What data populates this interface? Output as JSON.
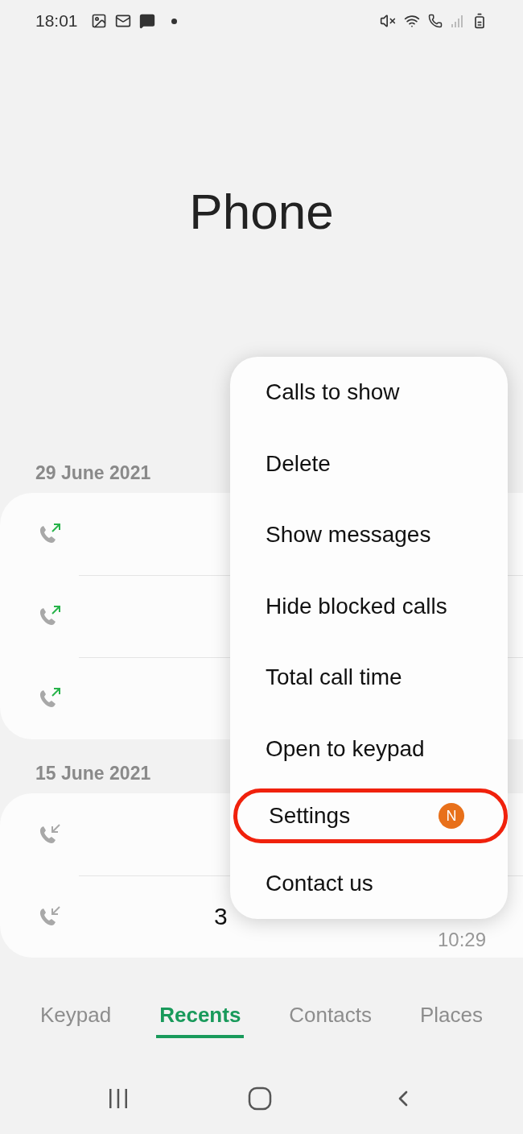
{
  "status_bar": {
    "time": "18:01"
  },
  "title": "Phone",
  "call_groups": [
    {
      "date": "29 June 2021",
      "calls": [
        {
          "kind": "outgoing"
        },
        {
          "kind": "outgoing"
        },
        {
          "kind": "outgoing"
        }
      ]
    },
    {
      "date": "15 June 2021",
      "calls": [
        {
          "kind": "incoming"
        },
        {
          "kind": "incoming",
          "name": "3",
          "time": "10:29"
        }
      ]
    }
  ],
  "menu": {
    "items": [
      {
        "label": "Calls to show",
        "highlighted": false
      },
      {
        "label": "Delete",
        "highlighted": false
      },
      {
        "label": "Show messages",
        "highlighted": false
      },
      {
        "label": "Hide blocked calls",
        "highlighted": false
      },
      {
        "label": "Total call time",
        "highlighted": false
      },
      {
        "label": "Open to keypad",
        "highlighted": false
      },
      {
        "label": "Settings",
        "highlighted": true,
        "badge": "N",
        "color": "#e8701a"
      },
      {
        "label": "Contact us",
        "highlighted": false
      }
    ]
  },
  "tabs": [
    {
      "label": "Keypad",
      "selected": false
    },
    {
      "label": "Recents",
      "selected": true
    },
    {
      "label": "Contacts",
      "selected": false
    },
    {
      "label": "Places",
      "selected": false
    }
  ]
}
